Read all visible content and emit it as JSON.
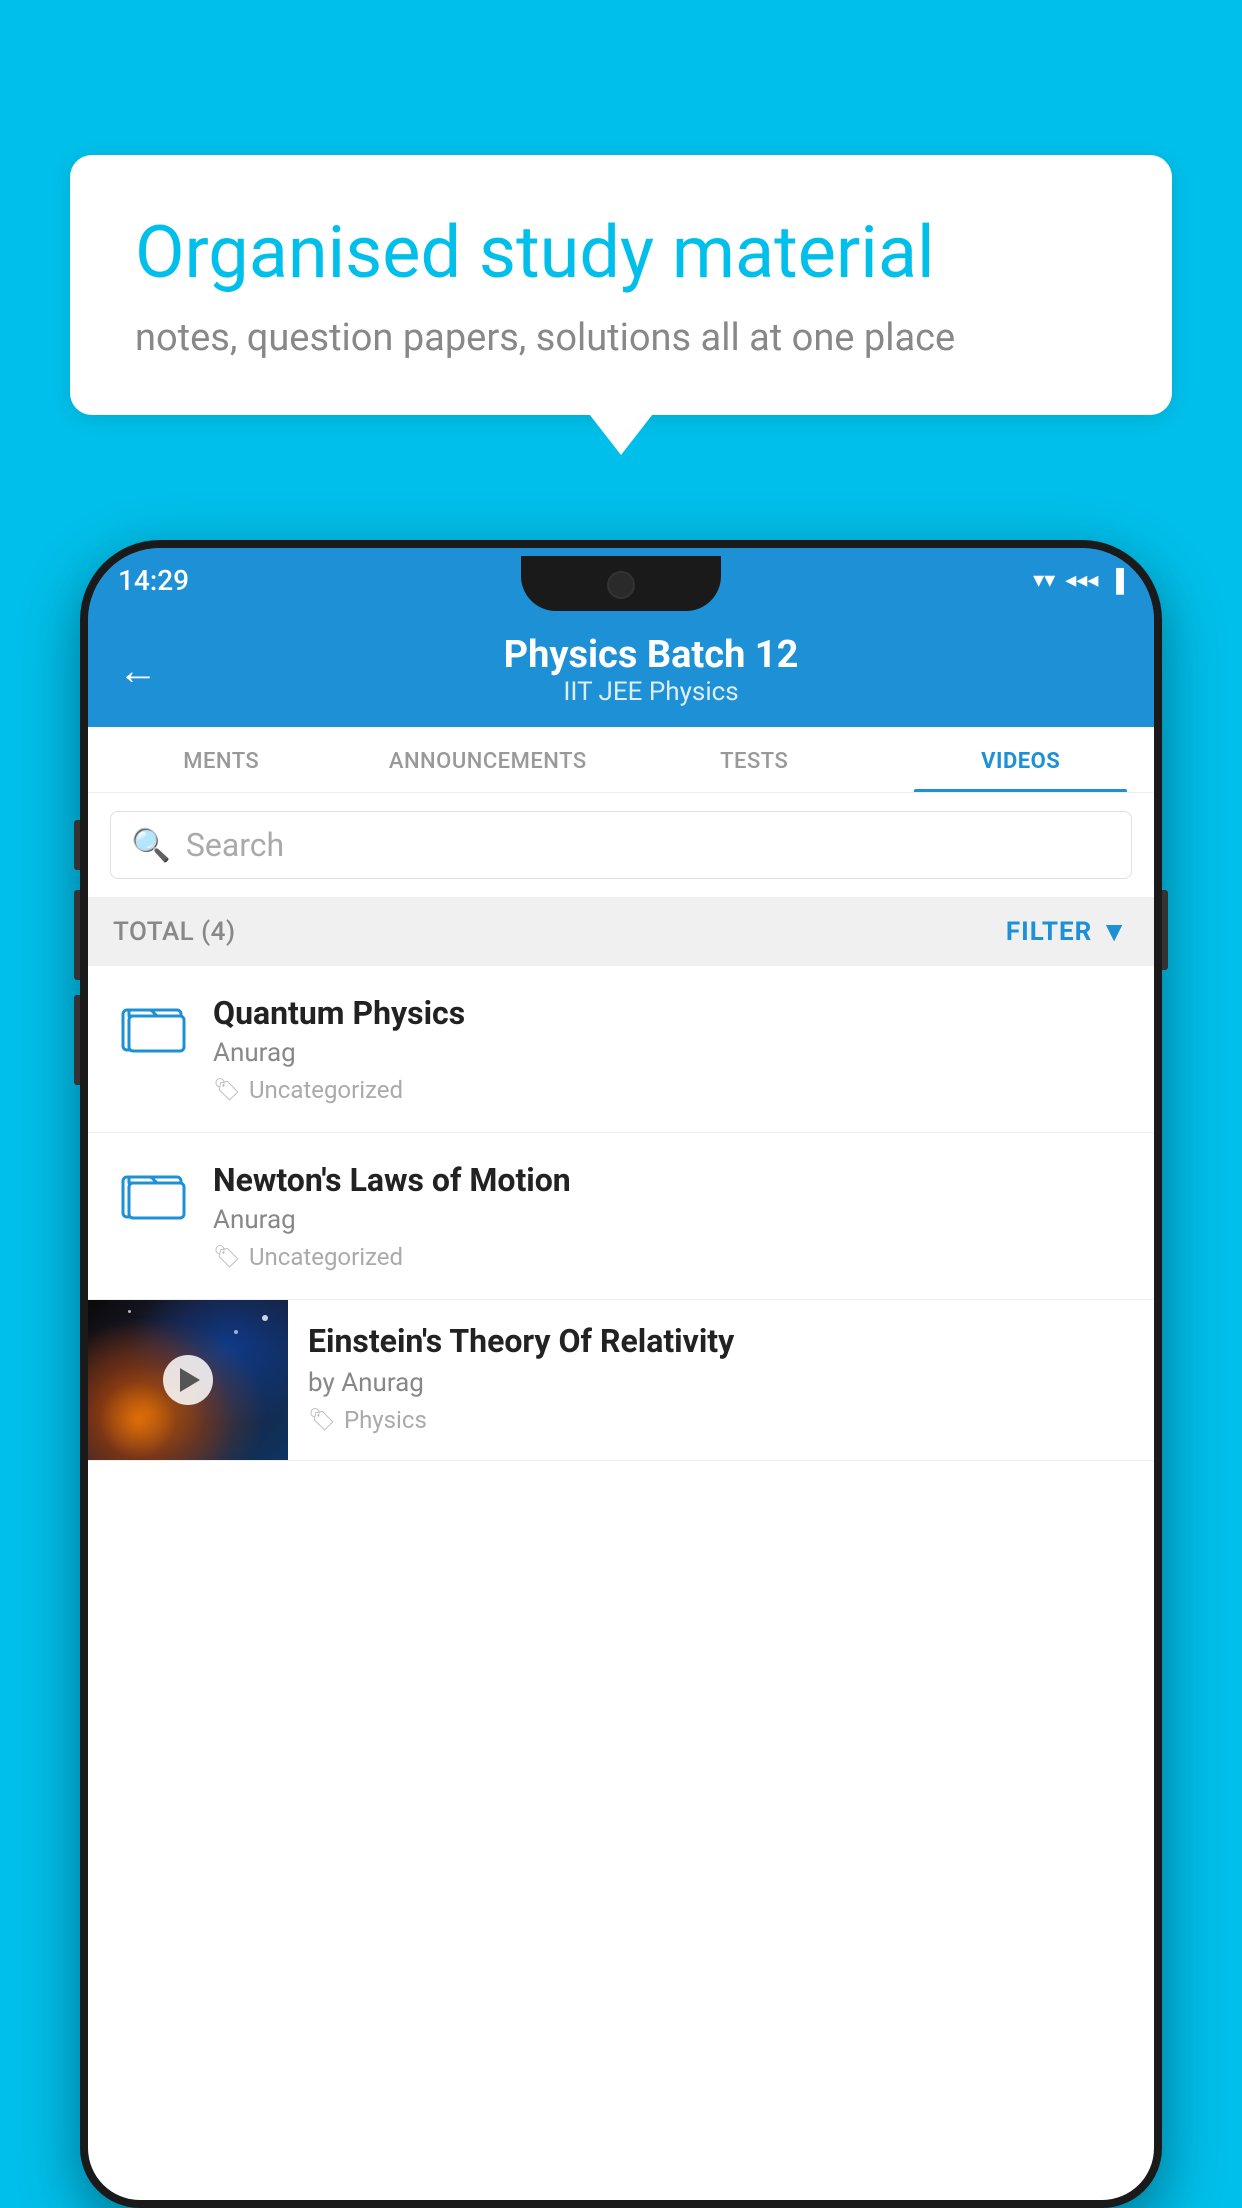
{
  "background_color": "#00BFEA",
  "speech_bubble": {
    "title": "Organised study material",
    "subtitle": "notes, question papers, solutions all at one place"
  },
  "status_bar": {
    "time": "14:29",
    "wifi": "▼",
    "signal": "◀",
    "battery": "▮"
  },
  "app_header": {
    "back_label": "←",
    "title": "Physics Batch 12",
    "subtitle": "IIT JEE    Physics"
  },
  "tabs": [
    {
      "label": "MENTS",
      "active": false
    },
    {
      "label": "ANNOUNCEMENTS",
      "active": false
    },
    {
      "label": "TESTS",
      "active": false
    },
    {
      "label": "VIDEOS",
      "active": true
    }
  ],
  "search": {
    "placeholder": "Search"
  },
  "filter_bar": {
    "total_label": "TOTAL (4)",
    "filter_label": "FILTER"
  },
  "list_items": [
    {
      "id": 1,
      "title": "Quantum Physics",
      "author": "Anurag",
      "tag": "Uncategorized",
      "type": "folder"
    },
    {
      "id": 2,
      "title": "Newton's Laws of Motion",
      "author": "Anurag",
      "tag": "Uncategorized",
      "type": "folder"
    },
    {
      "id": 3,
      "title": "Einstein's Theory Of Relativity",
      "author": "by Anurag",
      "tag": "Physics",
      "type": "video"
    }
  ],
  "icons": {
    "back": "←",
    "search": "🔍",
    "filter_funnel": "▼",
    "tag": "🏷",
    "play": "▶"
  }
}
